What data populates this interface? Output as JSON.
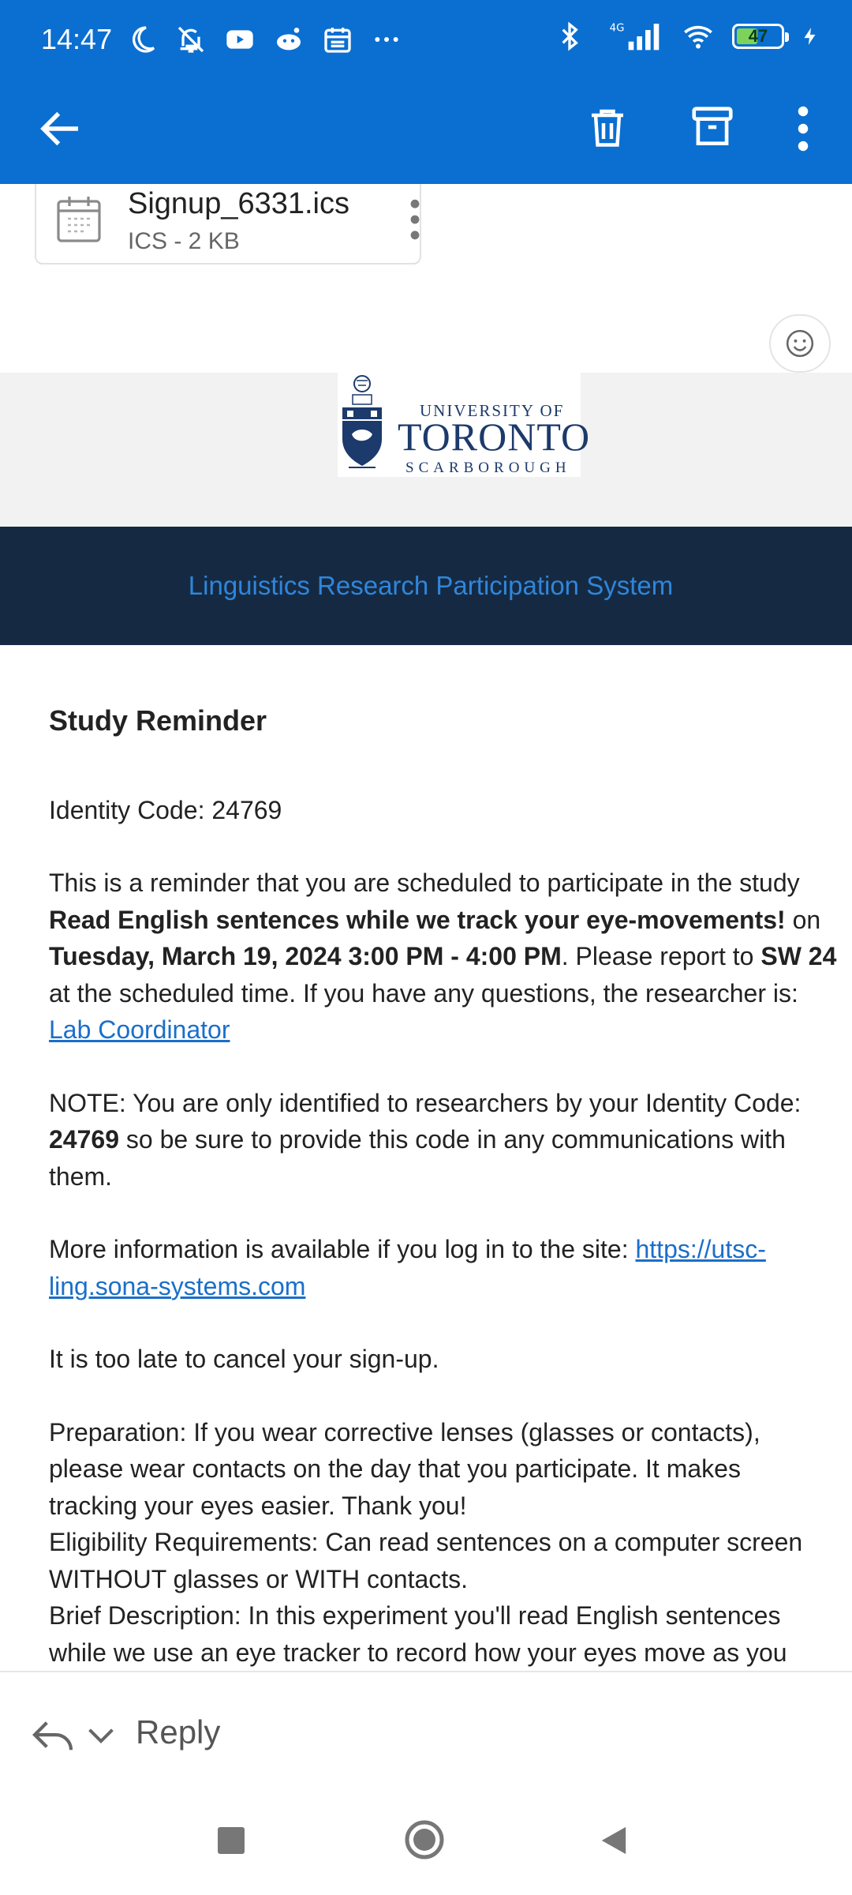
{
  "status_bar": {
    "time": "14:47",
    "network": "4G",
    "battery": "47"
  },
  "app_bar": {
    "icons": [
      "back-arrow-icon",
      "trash-icon",
      "archive-icon",
      "more-vert-icon"
    ]
  },
  "attachment": {
    "name": "Signup_6331.ics",
    "meta": "ICS - 2 KB"
  },
  "banner": {
    "logo_university_of": "UNIVERSITY OF",
    "logo_toronto": "TORONTO",
    "logo_scarborough": "SCARBOROUGH",
    "title": "Linguistics Research Participation System"
  },
  "email": {
    "heading": "Study Reminder",
    "identity_line": "Identity Code: 24769",
    "reminder_1": "This is a reminder that you are scheduled to participate in the study",
    "study_name": "Read English sentences while we track your eye-movements!",
    "on": " on",
    "datetime": "Tuesday, March 19, 2024 3:00 PM - 4:00 PM",
    "report_to": ". Please report to ",
    "location": "SW 24",
    "reminder_3": "at the scheduled time. If you have any questions, the researcher is:",
    "researcher_link": "Lab Coordinator",
    "note_1": "NOTE: You are only identified to researchers by your Identity Code:",
    "note_code": "24769",
    "note_2": " so be sure to provide this code in any communications with",
    "note_3": "them.",
    "more_info_1": "More information is available if you log in to the site: ",
    "more_info_link_1": "https://utsc-",
    "more_info_link_2": "ling.sona-systems.com",
    "cancel_line": "It is too late to cancel your sign-up.",
    "prep_1": "Preparation: If you wear corrective lenses (glasses or contacts),",
    "prep_2": "please wear contacts on the day that you participate. It makes",
    "prep_3": "tracking your eyes easier. Thank you!",
    "elig_1": "Eligibility Requirements: Can read sentences on a computer screen",
    "elig_2": "WITHOUT glasses or WITH contacts.",
    "brief_1": "Brief Description: In this experiment you'll read English sentences",
    "brief_2": "while we use an eye tracker to record how your eyes move as you"
  },
  "reply_bar": {
    "label": "Reply"
  },
  "colors": {
    "app_bar": "#0a6fd1",
    "title_band": "#152a42",
    "title_text": "#2f86dc",
    "link": "#1a6fc9"
  }
}
